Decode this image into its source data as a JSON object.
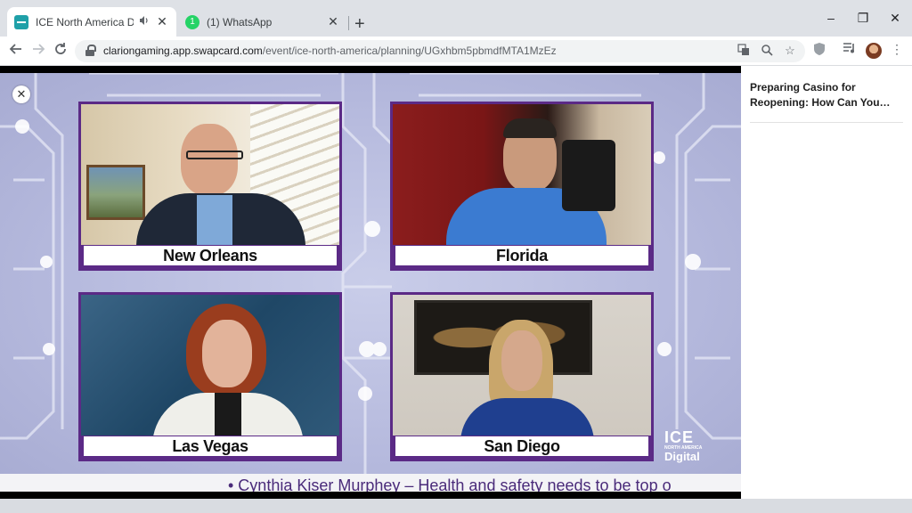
{
  "tabs": [
    {
      "title": "ICE North America Digital - M",
      "favicon_color": "#1fa0a8",
      "audio_icon": "speaker-icon"
    },
    {
      "title": "(1) WhatsApp",
      "favicon_color": "#25d366",
      "badge": "1"
    }
  ],
  "window_controls": {
    "minimize": "–",
    "restore": "❐",
    "close": "✕"
  },
  "address_bar": {
    "host": "clariongaming.app.swapcard.com",
    "path": "/event/ice-north-america/planning/UGxhbm5pbmdfMTA1MzEz"
  },
  "video": {
    "tiles": [
      {
        "label": "New Orleans"
      },
      {
        "label": "Florida"
      },
      {
        "label": "Las Vegas"
      },
      {
        "label": "San Diego"
      }
    ],
    "logo": {
      "top": "ICE",
      "sub": "NORTH AMERICA",
      "bottom": "Digital"
    },
    "ticker": "• Cynthia Kiser Murphey – Health and safety needs to be top o",
    "accent_color": "#5b2a86"
  },
  "side_panel": {
    "session_title": "Preparing Casino for Reopening: How Can You…"
  }
}
